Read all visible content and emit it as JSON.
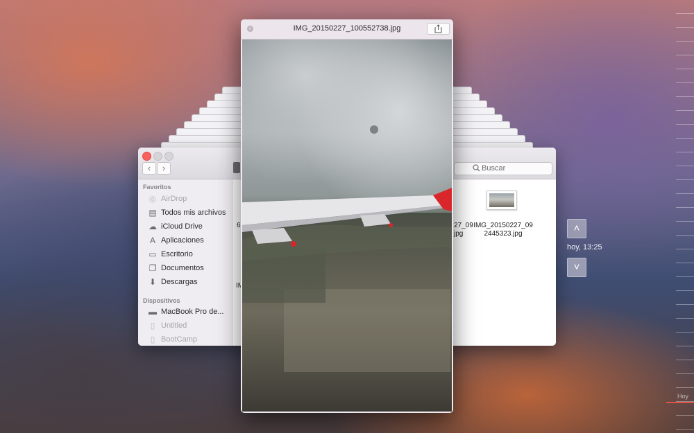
{
  "quicklook": {
    "title": "IMG_20150227_100552738.jpg",
    "close_icon": "close-icon",
    "share_icon": "share-icon"
  },
  "finder": {
    "search_placeholder": "Buscar",
    "sidebar": {
      "favorites_header": "Favoritos",
      "favorites": [
        {
          "label": "AirDrop",
          "icon": "airdrop-icon"
        },
        {
          "label": "Todos mis archivos",
          "icon": "all-files-icon"
        },
        {
          "label": "iCloud Drive",
          "icon": "cloud-icon"
        },
        {
          "label": "Aplicaciones",
          "icon": "applications-icon"
        },
        {
          "label": "Escritorio",
          "icon": "desktop-icon"
        },
        {
          "label": "Documentos",
          "icon": "documents-icon"
        },
        {
          "label": "Descargas",
          "icon": "downloads-icon"
        }
      ],
      "devices_header": "Dispositivos",
      "devices": [
        {
          "label": "MacBook Pro de...",
          "icon": "laptop-icon"
        },
        {
          "label": "Untitled",
          "icon": "disk-icon"
        },
        {
          "label": "BootCamp",
          "icon": "disk-icon"
        }
      ]
    },
    "files": {
      "left_fragment_1": "6",
      "left_fragment_2": "IM",
      "partial_name_line1": "27_09",
      "partial_name_line2": "jpg",
      "file_name_line1": "IMG_20150227_09",
      "file_name_line2": "2445323.jpg"
    }
  },
  "time_machine": {
    "date_label": "hoy, 13:25",
    "timeline_label": "Hoy",
    "accent": "#e0524a"
  }
}
